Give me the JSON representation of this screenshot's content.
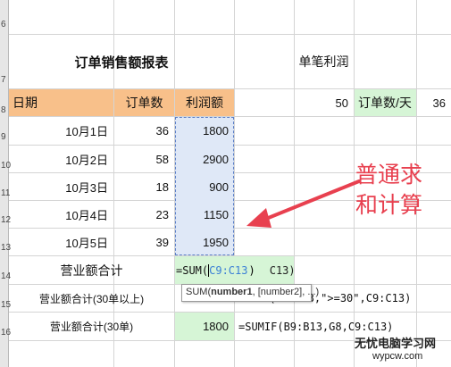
{
  "rows": [
    "6",
    "7",
    "8",
    "9",
    "10",
    "11",
    "12",
    "13",
    "14",
    "15",
    "16"
  ],
  "title": "订单销售额报表",
  "single_profit_label": "单笔利润",
  "headers": {
    "date": "日期",
    "orders": "订单数",
    "profit": "利润额"
  },
  "side": {
    "value": "50",
    "label": "订单数/天",
    "value2": "36"
  },
  "data_rows": [
    {
      "date": "10月1日",
      "orders": "36",
      "profit": "1800"
    },
    {
      "date": "10月2日",
      "orders": "58",
      "profit": "2900"
    },
    {
      "date": "10月3日",
      "orders": "18",
      "profit": "900"
    },
    {
      "date": "10月4日",
      "orders": "23",
      "profit": "1150"
    },
    {
      "date": "10月5日",
      "orders": "39",
      "profit": "1950"
    }
  ],
  "summary": {
    "total_label": "营业额合计",
    "total_formula_editing": "=SUM(",
    "total_formula_ref": "C9:C13",
    "total_formula_shadow": "C13)",
    "over30_label": "营业额合计(30单以上)",
    "over30_formula": "=SUMIF(B9:B13,\">=30\",C9:C13)",
    "eq30_label": "营业额合计(30单)",
    "eq30_value": "1800",
    "eq30_formula": "=SUMIF(B9:B13,G8,C9:C13)"
  },
  "tooltip": {
    "fn": "SUM(",
    "arg1": "number1",
    "rest": ", [number2], ...)"
  },
  "annotation": {
    "line1": "普通求",
    "line2": "和计算"
  },
  "watermark": {
    "line1": "无忧电脑学习网",
    "line2": "wypcw.com"
  },
  "colors": {
    "header": "#f8c08a",
    "selection": "#dfe8f7",
    "green": "#d6f5d6",
    "arrow": "#e8404f"
  }
}
